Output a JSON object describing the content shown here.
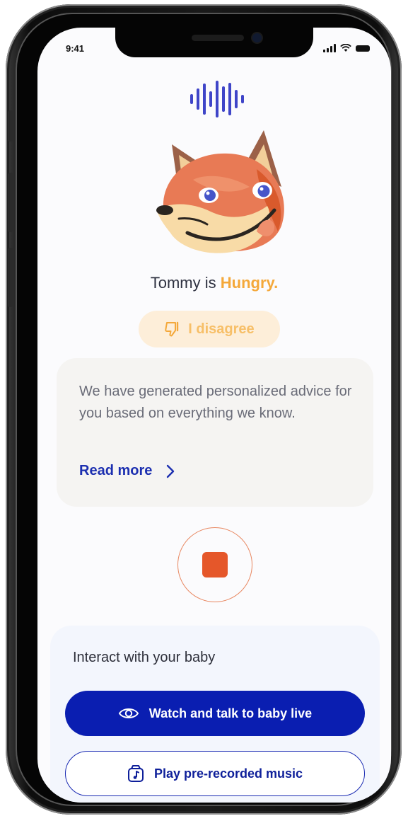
{
  "status_bar": {
    "time": "9:41"
  },
  "mascot": {
    "icon": "fox-face-icon"
  },
  "status": {
    "prefix": "Tommy is",
    "mood": "Hungry.",
    "mood_color": "#f4a83a"
  },
  "disagree": {
    "label": "I disagree",
    "icon": "thumbs-down-icon"
  },
  "advice": {
    "text": "We have generated personalized advice for you based on everything we know.",
    "read_more": "Read more"
  },
  "recording": {
    "stop_icon": "stop-icon",
    "accent": "#e5572a"
  },
  "interact": {
    "title": "Interact with your baby",
    "watch_label": "Watch and talk to baby live",
    "music_label": "Play pre-recorded music"
  },
  "colors": {
    "primary": "#0a1eb1",
    "accent_orange": "#e5572a",
    "highlight": "#f4a83a"
  }
}
